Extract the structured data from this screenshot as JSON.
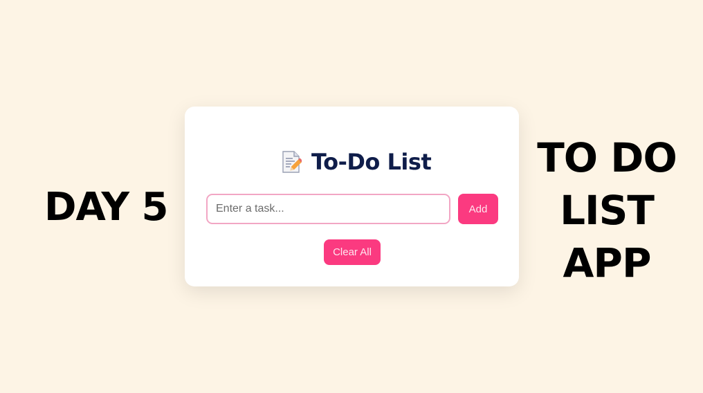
{
  "left_caption": "DAY 5",
  "right_caption": {
    "line1": "TO DO",
    "line2": "LIST",
    "line3": "APP"
  },
  "app": {
    "title_icon": "memo-icon",
    "title": "To-Do List",
    "task_input": {
      "placeholder": "Enter a task...",
      "value": ""
    },
    "add_label": "Add",
    "clear_label": "Clear All"
  },
  "colors": {
    "background": "#fdf4e5",
    "card": "#ffffff",
    "title": "#0f1d4a",
    "accent": "#fb3a80",
    "input_border": "#f2a6c4"
  }
}
